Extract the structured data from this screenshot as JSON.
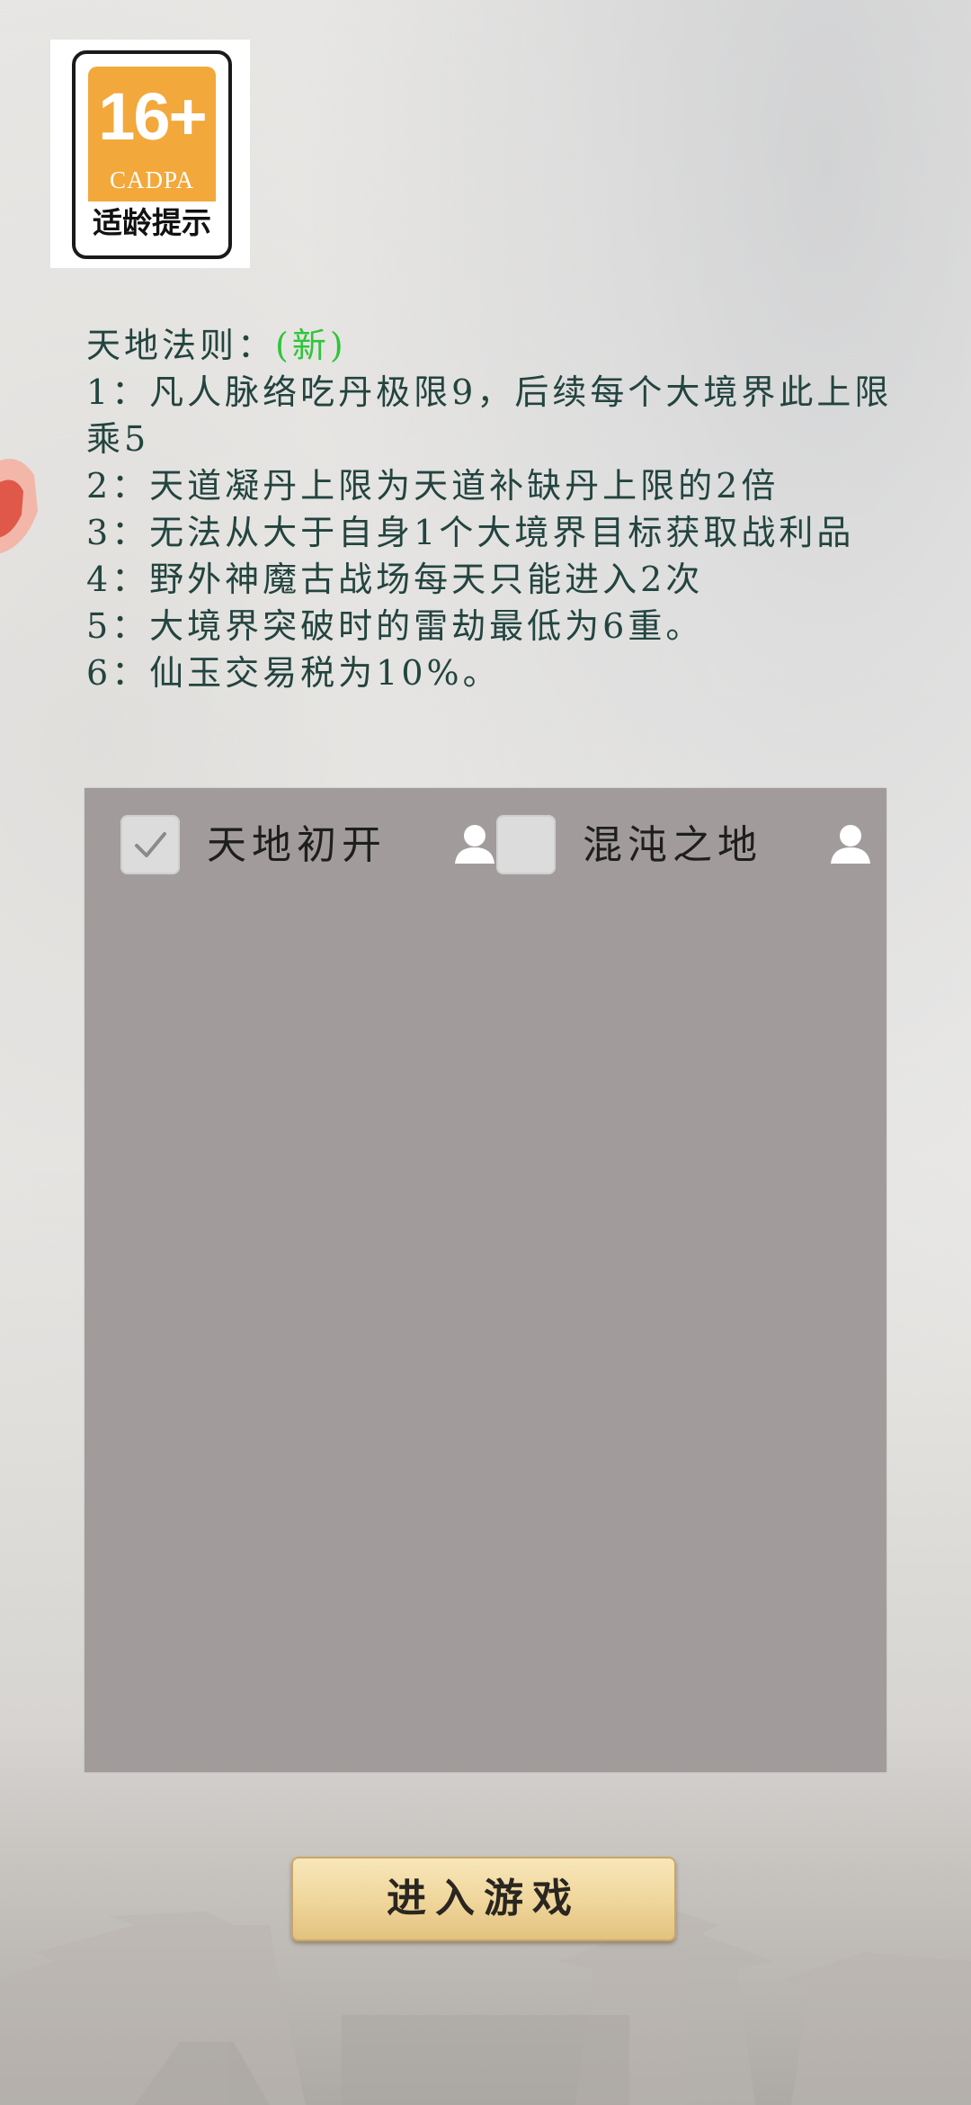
{
  "age_rating": {
    "number": "16+",
    "org": "CADPA",
    "label": "适龄提示",
    "color": "#f3a83b"
  },
  "rules": {
    "title": "天地法则：",
    "new_tag": "(新)",
    "lines": [
      "1：凡人脉络吃丹极限9，后续每个大境界此上限乘5",
      "2：天道凝丹上限为天道补缺丹上限的2倍",
      "3：无法从大于自身1个大境界目标获取战利品",
      "4：野外神魔古战场每天只能进入2次",
      "5：大境界突破时的雷劫最低为6重。",
      "6：仙玉交易税为10%。"
    ],
    "text_color": "#23443f",
    "new_tag_color": "#2fc53a"
  },
  "servers": [
    {
      "name": "天地初开",
      "checked": true,
      "icon": "user-icon"
    },
    {
      "name": "混沌之地",
      "checked": false,
      "icon": "user-icon"
    }
  ],
  "panel_color": "#a19c9b",
  "enter_button": {
    "label": "进入游戏"
  }
}
